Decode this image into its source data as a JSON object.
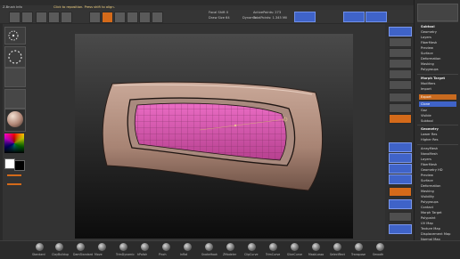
{
  "menu": [
    "Alpha",
    "Brush",
    "Color",
    "Document",
    "Draw",
    "Edit",
    "File",
    "Layer",
    "Light",
    "Macro",
    "Marker",
    "Material",
    "Movie",
    "Picker",
    "Preferences",
    "Render",
    "Stencil",
    "Stroke",
    "Texture",
    "Tool",
    "Transform",
    "Zplugin",
    "Zscript"
  ],
  "status": {
    "left": "Z-Brush Info",
    "hint": "Click to reposition. Press shift to align.",
    "focal": "Focal Shift 0",
    "draw_size": "Draw Size 64",
    "dynamic": "Dynamic",
    "active_points": "ActivePoints: 273",
    "total_points": "TotalPoints: 1.345 Mil"
  },
  "tray": {
    "items_top": [
      "Subtool",
      "Geometry",
      "Layers",
      "FiberMesh",
      "Preview",
      "Surface",
      "Deformation",
      "Masking",
      "Polygroups"
    ],
    "section1": "Morph Target",
    "mid": [
      "Modifiers",
      "Import",
      "Export",
      "Clone",
      "Goz",
      "Visible",
      "Subtool"
    ],
    "section2": "Geometry",
    "sub": [
      "Lower Res",
      "Higher Res",
      "Divide",
      "Reconstruct Subdiv",
      "Del Higher"
    ],
    "list": [
      "ArrayMesh",
      "NanoMesh",
      "Layers",
      "FiberMesh",
      "Geometry HD",
      "Preview",
      "Surface",
      "Deformation",
      "Masking",
      "Visibility",
      "Polygroups",
      "Contact",
      "Morph Target",
      "Polypaint",
      "UV Map",
      "Texture Map",
      "Displacement Map",
      "Normal Map",
      "Vector Displacement Map",
      "Display Properties",
      "Unified Skin"
    ]
  },
  "bottom_brushes": [
    "Standard",
    "ClayBuildup",
    "DamStandard",
    "Move",
    "TrimDynamic",
    "hPolish",
    "Pinch",
    "Inflat",
    "SnakeHook",
    "ZModeler",
    "ClipCurve",
    "TrimCurve",
    "SliceCurve",
    "MaskLasso",
    "SelectRect",
    "Transpose",
    "Smooth"
  ],
  "colors": {
    "accent_orange": "#d46a1a",
    "accent_blue": "#3f63c8",
    "mask_pink": "#e25ab8",
    "clay": "#c9a898"
  }
}
